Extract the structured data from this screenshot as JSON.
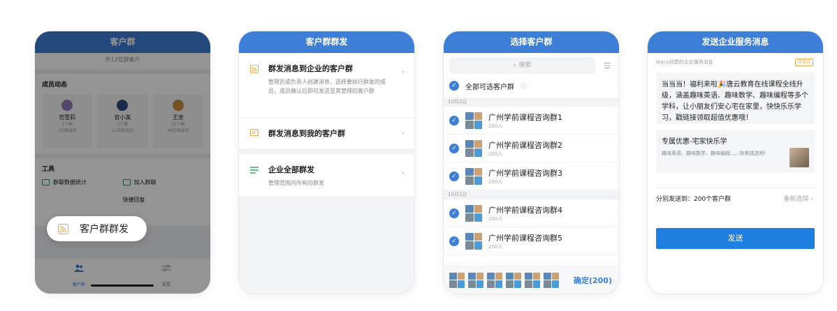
{
  "phone1": {
    "title": "客户群",
    "subtitle": "共12位群客户",
    "section_members": "成员动态",
    "members": [
      {
        "name": "范雪莉",
        "l1": "1个群",
        "l2": "1位群成员",
        "color": "#8a7ab8"
      },
      {
        "name": "官小美",
        "l1": "5个群",
        "l2": "12位群成员",
        "color": "#2c4b7c"
      },
      {
        "name": "王宠",
        "l1": "22个群",
        "l2": "49位群成员",
        "color": "#c98d3e"
      }
    ],
    "section_tools": "工具",
    "tools": [
      "群聊数据统计",
      "加入群聊",
      "",
      "快捷回复"
    ],
    "tabs": [
      {
        "label": "客户群",
        "active": true
      },
      {
        "label": "配置",
        "active": false
      }
    ],
    "popup_label": "客户群群发"
  },
  "phone2": {
    "title": "客户群群发",
    "items": [
      {
        "title": "群发消息到企业的客户群",
        "desc": "管理员或负责人创建消息，选择要执行群发的成员，成员确认后即可发送至其管理的客户群",
        "icon": "rss-icon"
      },
      {
        "title": "群发消息到我的客户群",
        "desc": "",
        "icon": "chat-icon"
      },
      {
        "title": "企业全部群发",
        "desc": "管理范围内所有的群发",
        "icon": "list-icon"
      }
    ]
  },
  "phone3": {
    "title": "选择客户群",
    "search_placeholder": "搜索",
    "select_all": "全部可选客户群",
    "sections": [
      {
        "date": "10月2日",
        "groups": [
          {
            "name": "广州学前课程咨询群1",
            "count": "200人"
          },
          {
            "name": "广州学前课程咨询群2",
            "count": "200人"
          },
          {
            "name": "广州学前课程咨询群3",
            "count": "200人"
          }
        ]
      },
      {
        "date": "10月1日",
        "groups": [
          {
            "name": "广州学前课程咨询群4",
            "count": "200人"
          },
          {
            "name": "广州学前课程咨询群5",
            "count": "200人"
          }
        ]
      }
    ],
    "confirm_label": "确定(200)"
  },
  "phone4": {
    "title": "发送企业服务消息",
    "creator": "stacy创建的企业服务消息",
    "status": "待发送",
    "message": "当当当！福利来啦🎉唐云教育在线课程全线升级，涵盖趣味英语、趣味数学、趣味编程等多个学科，让小朋友们安心宅在家里，快快乐乐学习，戳链接领取超值优惠哦！",
    "link_title": "专属优惠-宅家快乐学",
    "link_desc": "趣味英语、趣味数学、趣味编程......快来挑选吧!",
    "send_to": "分别发送到：200个客户群",
    "reselect": "重新选择",
    "send_button": "发送"
  },
  "colors": {
    "primary": "#3d7fd6",
    "send": "#1f7fe0",
    "green": "#2e9e55",
    "orange": "#f0a94a"
  }
}
